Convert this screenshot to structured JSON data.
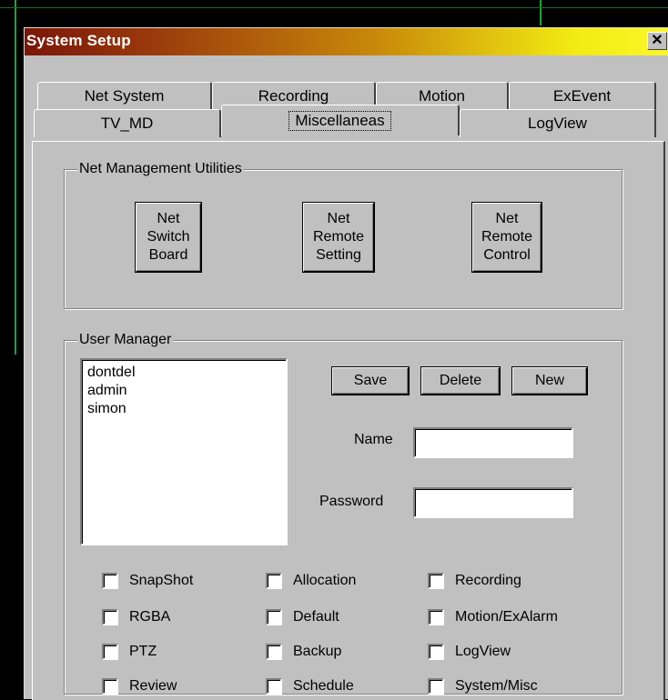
{
  "window": {
    "title": "System Setup",
    "close_glyph": "✕"
  },
  "tabs": {
    "row1": [
      "Net System",
      "Recording",
      "Motion",
      "ExEvent"
    ],
    "row2": [
      "TV_MD",
      "Miscellaneas",
      "LogView"
    ],
    "active": "Miscellaneas"
  },
  "net_mgmt": {
    "legend": "Net Management Utilities",
    "buttons": [
      [
        "Net",
        "Switch",
        "Board"
      ],
      [
        "Net",
        "Remote",
        "Setting"
      ],
      [
        "Net",
        "Remote",
        "Control"
      ]
    ]
  },
  "user_manager": {
    "legend": "User Manager",
    "users": [
      "dontdel",
      "admin",
      "simon"
    ],
    "save": "Save",
    "delete": "Delete",
    "new": "New",
    "name_label": "Name",
    "name_value": "",
    "password_label": "Password",
    "password_value": "",
    "permissions": [
      [
        "SnapShot",
        "Allocation",
        "Recording"
      ],
      [
        "RGBA",
        "Default",
        "Motion/ExAlarm"
      ],
      [
        "PTZ",
        "Backup",
        "LogView"
      ],
      [
        "Review",
        "Schedule",
        "System/Misc"
      ]
    ]
  },
  "colors": {
    "title_gradient_start": "#7a1608",
    "title_gradient_end": "#fbf72a",
    "face": "#c0c0c0"
  }
}
